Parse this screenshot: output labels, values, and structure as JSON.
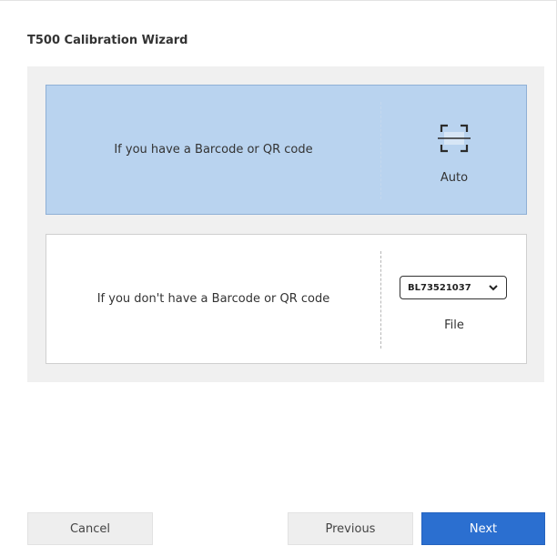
{
  "window": {
    "title": "T500 Calibration Wizard"
  },
  "options": {
    "auto": {
      "description": "If you have a Barcode or QR code",
      "icon": "barcode-scan-icon",
      "label": "Auto",
      "selected": true
    },
    "file": {
      "description": "If you don't have a Barcode or QR code",
      "select_value": "BL73521037",
      "label": "File",
      "selected": false
    }
  },
  "footer": {
    "cancel_label": "Cancel",
    "previous_label": "Previous",
    "next_label": "Next"
  },
  "colors": {
    "selected_option_bg": "#b9d3ef",
    "panel_bg": "#f0f0f0",
    "primary_button": "#2b6fd0",
    "secondary_button": "#eeeeee"
  }
}
